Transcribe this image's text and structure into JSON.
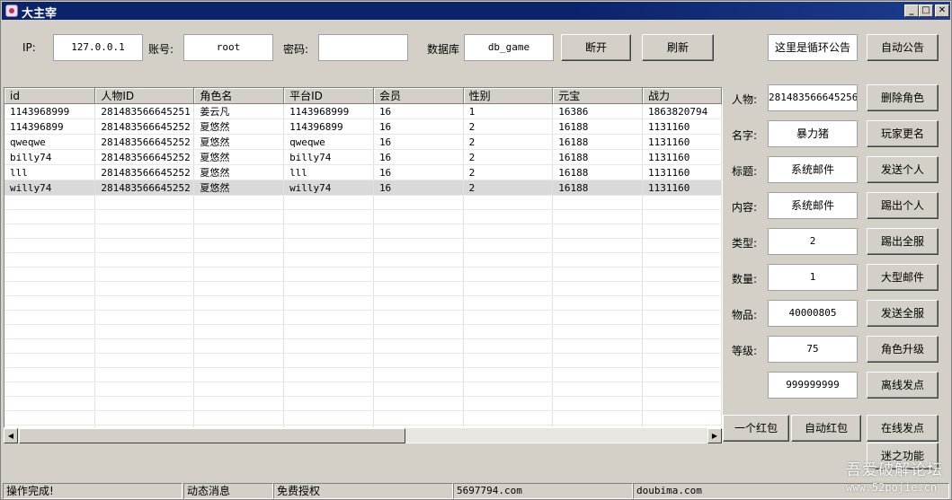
{
  "window": {
    "title": "大主宰"
  },
  "connection": {
    "ip_label": "IP:",
    "ip_value": "127.0.0.1",
    "account_label": "账号:",
    "account_value": "root",
    "password_label": "密码:",
    "password_value": "",
    "db_label": "数据库",
    "db_value": "db_game",
    "disconnect_label": "断开",
    "refresh_label": "刷新"
  },
  "announcement": {
    "text": "这里是循环公告",
    "auto_label": "自动公告"
  },
  "table": {
    "columns": [
      "id",
      "人物ID",
      "角色名",
      "平台ID",
      "会员",
      "性别",
      "元宝",
      "战力"
    ],
    "rows": [
      [
        "1143968999",
        "281483566645251",
        "姜云凡",
        "1143968999",
        "16",
        "1",
        "16386",
        "1863820794"
      ],
      [
        "114396899",
        "281483566645252",
        "夏悠然",
        "114396899",
        "16",
        "2",
        "16188",
        "1131160"
      ],
      [
        "qweqwe",
        "281483566645252",
        "夏悠然",
        "qweqwe",
        "16",
        "2",
        "16188",
        "1131160"
      ],
      [
        "billy74",
        "281483566645252",
        "夏悠然",
        "billy74",
        "16",
        "2",
        "16188",
        "1131160"
      ],
      [
        "lll",
        "281483566645252",
        "夏悠然",
        "lll",
        "16",
        "2",
        "16188",
        "1131160"
      ],
      [
        "willy74",
        "281483566645252",
        "夏悠然",
        "willy74",
        "16",
        "2",
        "16188",
        "1131160"
      ]
    ],
    "selected_row": 5
  },
  "form": {
    "character_label": "人物:",
    "character_value": "281483566645256",
    "name_label": "名字:",
    "name_value": "暴力猪",
    "subject_label": "标题:",
    "subject_value": "系统邮件",
    "content_label": "内容:",
    "content_value": "系统邮件",
    "type_label": "类型:",
    "type_value": "2",
    "quantity_label": "数量:",
    "quantity_value": "1",
    "item_label": "物品:",
    "item_value": "40000805",
    "level_label": "等级:",
    "level_value": "75",
    "points_value": "999999999"
  },
  "actions": {
    "delete_role": "删除角色",
    "rename_player": "玩家更名",
    "send_personal": "发送个人",
    "kick_personal": "踢出个人",
    "kick_all": "踢出全服",
    "big_mail": "大型邮件",
    "send_all": "发送全服",
    "role_upgrade": "角色升级",
    "offline_points": "离线发点",
    "one_red_packet": "一个红包",
    "auto_red_packet": "自动红包",
    "online_points": "在线发点",
    "mystery_function": "迷之功能"
  },
  "statusbar": {
    "status": "操作完成!",
    "news": "动态消息",
    "license": "免费授权",
    "site1": "5697794.com",
    "site2": "doubima.com"
  },
  "watermark": {
    "line1": "吾爱破解论坛",
    "line2": "www.52pojie.cn"
  }
}
